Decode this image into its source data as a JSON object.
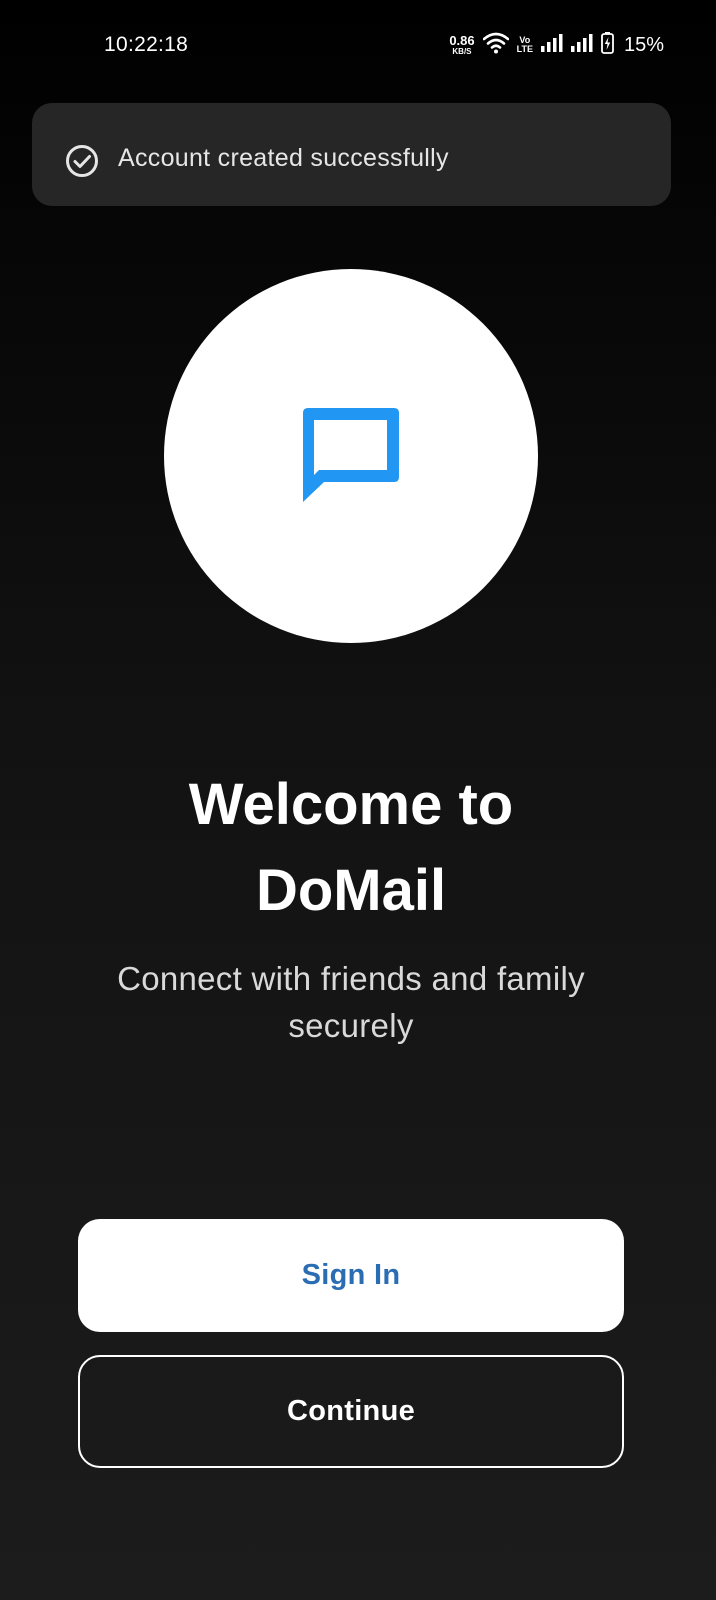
{
  "status_bar": {
    "time": "10:22:18",
    "net_speed_value": "0.86",
    "net_speed_unit": "KB/S",
    "volte_top": "Vo",
    "volte_bottom": "LTE",
    "battery_percent": "15%",
    "icons": [
      "wifi-icon",
      "signal-icon",
      "signal-icon",
      "battery-charging-icon"
    ]
  },
  "toast": {
    "icon": "check-circle-icon",
    "message": "Account created successfully"
  },
  "logo": {
    "icon": "chat-bubble-icon",
    "icon_color": "#2196F3"
  },
  "welcome": {
    "title_line1": "Welcome to",
    "title_line2": "DoMail",
    "subtitle_line1": "Connect with friends and family",
    "subtitle_line2": "securely"
  },
  "actions": {
    "sign_in_label": "Sign In",
    "continue_label": "Continue"
  },
  "colors": {
    "accent_text": "#2A6DB3",
    "toast_bg": "#262626"
  }
}
